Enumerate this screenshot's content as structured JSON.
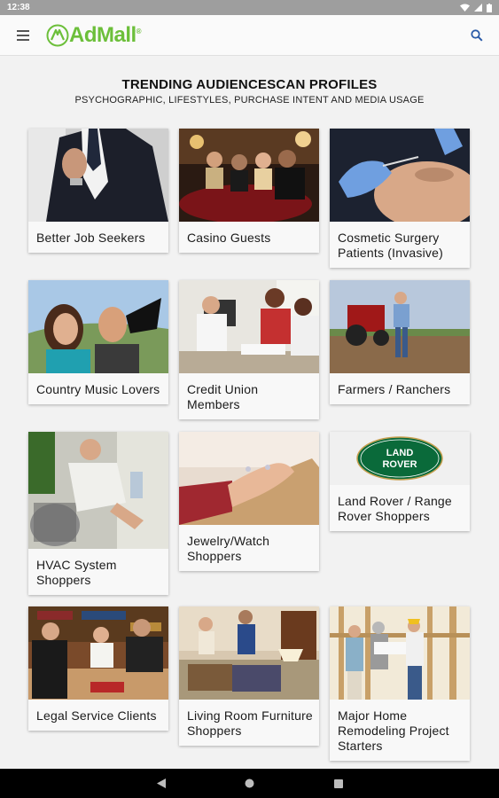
{
  "status": {
    "time": "12:38"
  },
  "app": {
    "logo": "AdMall",
    "logo_mark": "®"
  },
  "page": {
    "title": "TRENDING AUDIENCESCAN PROFILES",
    "subtitle": "PSYCHOGRAPHIC, LIFESTYLES, PURCHASE INTENT AND MEDIA USAGE"
  },
  "profiles": [
    {
      "label": "Better Job Seekers"
    },
    {
      "label": "Casino Guests"
    },
    {
      "label": "Cosmetic Surgery Patients (Invasive)"
    },
    {
      "label": "Country Music Lovers"
    },
    {
      "label": "Credit Union Members"
    },
    {
      "label": "Farmers / Ranchers"
    },
    {
      "label": "HVAC System Shoppers"
    },
    {
      "label": "Jewelry/Watch Shoppers"
    },
    {
      "label": "Land Rover / Range Rover Shoppers",
      "logo_text": "LAND ROVER"
    },
    {
      "label": "Legal Service Clients"
    },
    {
      "label": "Living Room Furniture Shoppers"
    },
    {
      "label": "Major Home Remodeling Project Starters"
    }
  ],
  "icons": {
    "menu": "hamburger-icon",
    "search": "search-icon",
    "back": "back-triangle-icon",
    "home": "home-circle-icon",
    "recents": "recents-square-icon"
  }
}
